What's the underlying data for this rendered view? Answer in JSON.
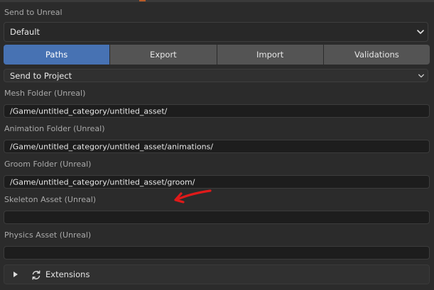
{
  "panel": {
    "title": "Send to Unreal",
    "preset": "Default"
  },
  "tabs": [
    {
      "label": "Paths",
      "active": true
    },
    {
      "label": "Export",
      "active": false
    },
    {
      "label": "Import",
      "active": false
    },
    {
      "label": "Validations",
      "active": false
    }
  ],
  "send_mode": "Send to Project",
  "fields": {
    "mesh": {
      "label": "Mesh Folder (Unreal)",
      "value": "/Game/untitled_category/untitled_asset/"
    },
    "animation": {
      "label": "Animation Folder (Unreal)",
      "value": "/Game/untitled_category/untitled_asset/animations/"
    },
    "groom": {
      "label": "Groom Folder (Unreal)",
      "value": "/Game/untitled_category/untitled_asset/groom/"
    },
    "skeleton": {
      "label": "Skeleton Asset (Unreal)",
      "value": ""
    },
    "physics": {
      "label": "Physics Asset (Unreal)",
      "value": ""
    }
  },
  "extensions": {
    "label": "Extensions",
    "icon": "refresh-cycle-icon",
    "expanded": false
  },
  "colors": {
    "active_tab": "#4772b3",
    "annotation": "#e01a1a"
  }
}
